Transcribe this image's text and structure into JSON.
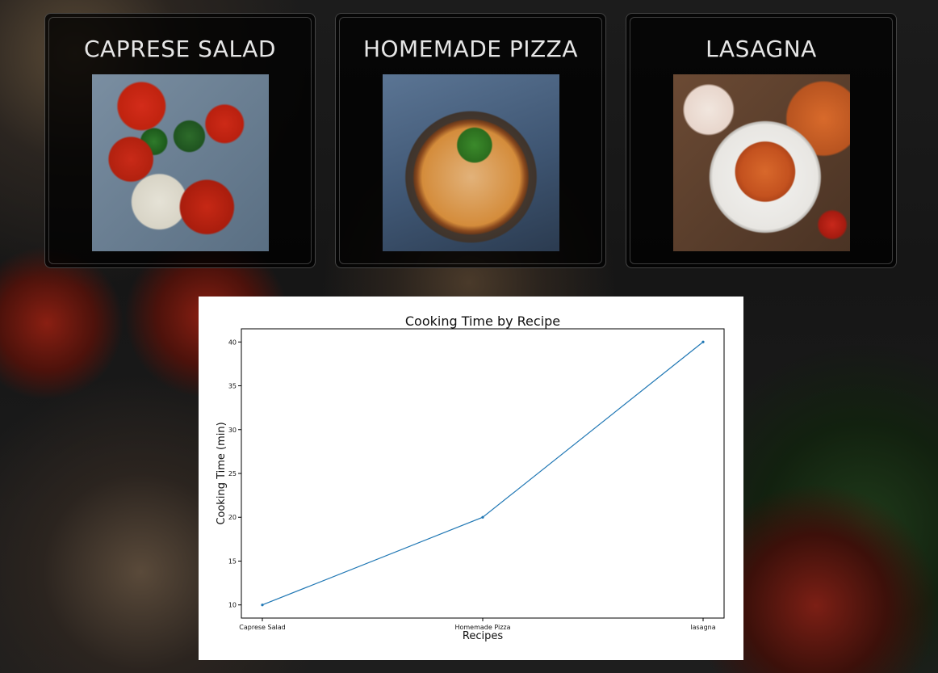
{
  "recipes": [
    {
      "title": "CAPRESE SALAD"
    },
    {
      "title": "HOMEMADE PIZZA"
    },
    {
      "title": "LASAGNA"
    }
  ],
  "chart": {
    "title": "Cooking Time by Recipe",
    "xlabel": "Recipes",
    "ylabel": "Cooking Time (min)"
  },
  "chart_data": {
    "type": "line",
    "categories": [
      "Caprese Salad",
      "Homemade Pizza",
      "lasagna"
    ],
    "values": [
      10,
      20,
      40
    ],
    "ylim": [
      8.5,
      41.5
    ],
    "yticks": [
      10,
      15,
      20,
      25,
      30,
      35,
      40
    ],
    "grid": false,
    "line_color": "#1f77b4"
  }
}
